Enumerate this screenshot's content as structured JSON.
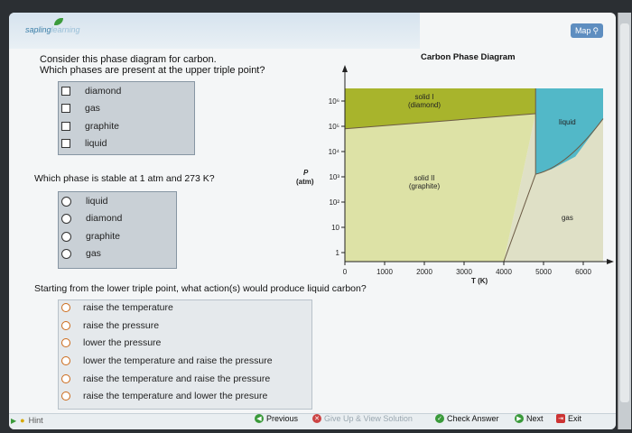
{
  "app": {
    "logo_text": "sapling",
    "logo_text_light": "learning",
    "map_label": "Map"
  },
  "question1": {
    "line1": "Consider this phase diagram for carbon.",
    "line2": "Which phases are present at the upper triple point?",
    "options": [
      "diamond",
      "gas",
      "graphite",
      "liquid"
    ]
  },
  "question2": {
    "text": "Which phase is stable at 1 atm and 273 K?",
    "options": [
      "liquid",
      "diamond",
      "graphite",
      "gas"
    ]
  },
  "question3": {
    "text": "Starting from the lower triple point, what action(s) would produce liquid carbon?",
    "options": [
      "raise the temperature",
      "raise the pressure",
      "lower the pressure",
      "lower the temperature and raise the pressure",
      "raise the temperature and raise the pressure",
      "raise the temperature and lower the presure"
    ]
  },
  "chart_data": {
    "type": "area",
    "title": "Carbon Phase Diagram",
    "ylabel_top": "P",
    "ylabel_unit": "(atm)",
    "xlabel": "T (K)",
    "x_ticks": [
      "0",
      "1000",
      "2000",
      "3000",
      "4000",
      "5000",
      "6000"
    ],
    "y_ticks": [
      "1",
      "10",
      "10²",
      "10³",
      "10⁴",
      "10⁵",
      "10⁶"
    ],
    "xlim": [
      0,
      6500
    ],
    "y_log_scale": true,
    "regions": [
      {
        "name": "solid I (diamond)",
        "label1": "solid I",
        "label2": "(diamond)",
        "color": "#a8b42c"
      },
      {
        "name": "solid II (graphite)",
        "label1": "solid II",
        "label2": "(graphite)",
        "color": "#dde2a6"
      },
      {
        "name": "liquid",
        "label1": "liquid",
        "label2": "",
        "color": "#52b8c8"
      },
      {
        "name": "gas",
        "label1": "gas",
        "label2": "",
        "color": "#dfe0c6"
      }
    ]
  },
  "footer": {
    "hint": "Hint",
    "previous": "Previous",
    "give_up": "Give Up & View Solution",
    "check": "Check Answer",
    "next": "Next",
    "exit": "Exit"
  }
}
